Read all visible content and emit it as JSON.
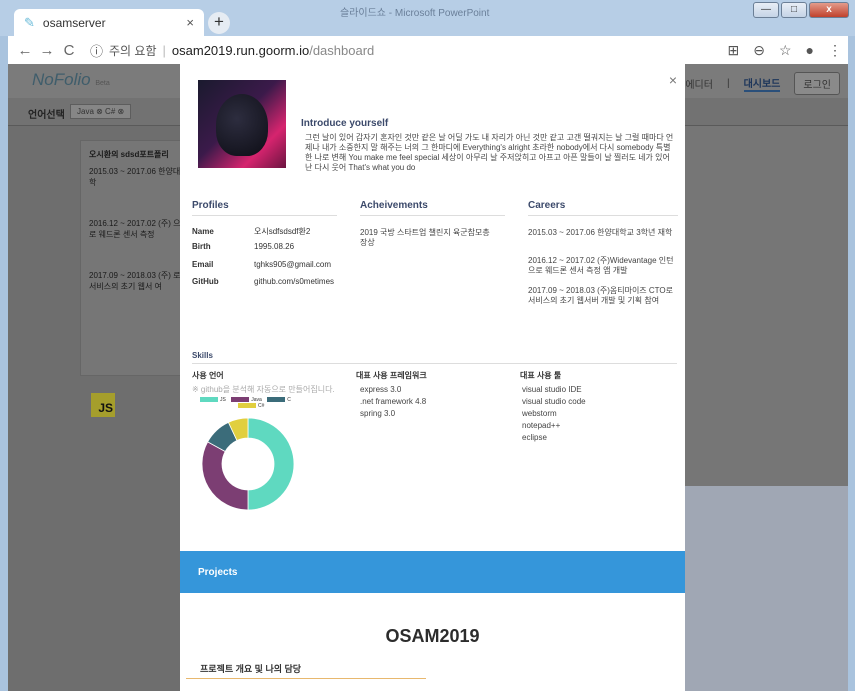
{
  "window": {
    "ghost_title": "슬라이드쇼 - Microsoft PowerPoint",
    "min": "—",
    "max": "□",
    "close": "x"
  },
  "browser": {
    "tab_title": "osamserver",
    "tab_close": "×",
    "new_tab": "+",
    "back": "←",
    "forward": "→",
    "reload": "C",
    "security_icon": "ⓘ",
    "security_text": "주의 요함",
    "url_host": "osam2019.run.goorm.io",
    "url_path": "/dashboard",
    "right_icons": [
      "⊞",
      "⊖",
      "☆",
      "●",
      "⋮"
    ]
  },
  "app": {
    "logo": "NoFolio",
    "logo_beta": "Beta",
    "nav": [
      {
        "label": "에디터"
      },
      {
        "label": "|"
      },
      {
        "label": "대시보드",
        "active": true
      },
      {
        "label": "로그인"
      }
    ],
    "filter_label": "언어선택",
    "filter_chips": "Java ⊗  C# ⊗",
    "bg_card": {
      "title": "오시환의 sdsd포트폴리",
      "items": [
        "2015.03 ~ 2017.06 한양대 학",
        "2016.12 ~ 2017.02 (주) 으로 웨드론 센서 측정",
        "2017.09 ~ 2018.03 (주) 로 서비스의 초기 웹서 여"
      ],
      "badge": "JS"
    }
  },
  "modal": {
    "close": "×",
    "intro_title": "Introduce yourself",
    "intro_text": "그런 날이 있어 갑자기 혼자인 것만 같은 날 어딜 가도 내 자리가 아닌 것만 같고 고갠 떨궈지는 날 그럴 때마다 언제나 내가 소중한지 말 해주는 너의 그 한마디에 Everything's alright 초라한 nobody에서 다시 somebody 특별한 나로 변해 You make me feel special 세상이 아무리 날 주저앉히고 아프고 아픈 말들이 날 찔러도 네가 있어 난 다시 웃어 That's what you do",
    "profiles_h": "Profiles",
    "achievements_h": "Acheivements",
    "careers_h": "Careers",
    "profile": [
      {
        "k": "Name",
        "v": "오시sdfsdsdf환2"
      },
      {
        "k": "Birth",
        "v": "1995.08.26"
      },
      {
        "k": "Email",
        "v": "tghks905@gmail.com"
      },
      {
        "k": "GitHub",
        "v": "github.com/s0metimes"
      }
    ],
    "achievement": "2019 국방 스타트업 챌린지 육군참모총장상",
    "careers": [
      "2015.03 ~ 2017.06 한양대학교 3학년 재학",
      "2016.12 ~ 2017.02 (주)Widevantage 인턴으로 웨드론 센서 측정 앱 개발",
      "2017.09 ~ 2018.03 (주)옴티마이즈 CTO로 서비스의 초기 웹서버 개발 및 기획 참여"
    ],
    "skills_h": "Skills",
    "langs_h": "사용 언어",
    "langs_note": "※ github을 분석해 자동으로 만들어집니다.",
    "frameworks_h": "대표 사용 프레임워크",
    "frameworks": [
      "express 3.0",
      ".net framework 4.8",
      "spring 3.0"
    ],
    "tools_h": "대표 사용 툴",
    "tools": [
      "visual studio IDE",
      "visual studio code",
      "webstorm",
      "notepad++",
      "eclipse"
    ],
    "projects_h": "Projects",
    "project_title": "OSAM2019",
    "overview_h": "프로젝트 개요 및 나의 담당"
  },
  "chart_data": {
    "type": "pie",
    "donut": true,
    "categories": [
      "JS",
      "Java",
      "C",
      "C#"
    ],
    "values": [
      50,
      33,
      10,
      7
    ],
    "colors": [
      "#5fd9c0",
      "#7c3e73",
      "#3b6c7a",
      "#e1cf3f"
    ],
    "legend_placement": "top"
  }
}
